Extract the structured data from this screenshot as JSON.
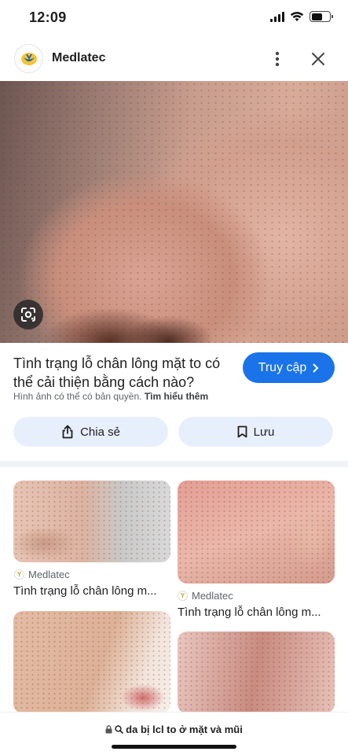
{
  "status": {
    "time": "12:09"
  },
  "header": {
    "site_name": "Medlatec"
  },
  "result": {
    "title": "Tình trạng lỗ chân lông mặt to có thể cải thiện bằng cách nào?",
    "visit_label": "Truy cập",
    "copyright_text": "Hình ảnh có thể có bản quyền.",
    "learn_more": "Tìm hiểu thêm",
    "share_label": "Chia sẻ",
    "save_label": "Lưu"
  },
  "related": [
    {
      "source": "Medlatec",
      "caption": "Tình trạng lỗ chân lông m..."
    },
    {
      "source": "Medlatec",
      "caption": "Tình trạng lỗ chân lông m..."
    }
  ],
  "url_bar": {
    "query": "da bị lcl to ở mặt và mũi"
  },
  "colors": {
    "accent": "#1a73e8",
    "action_bg": "#e8effc"
  }
}
